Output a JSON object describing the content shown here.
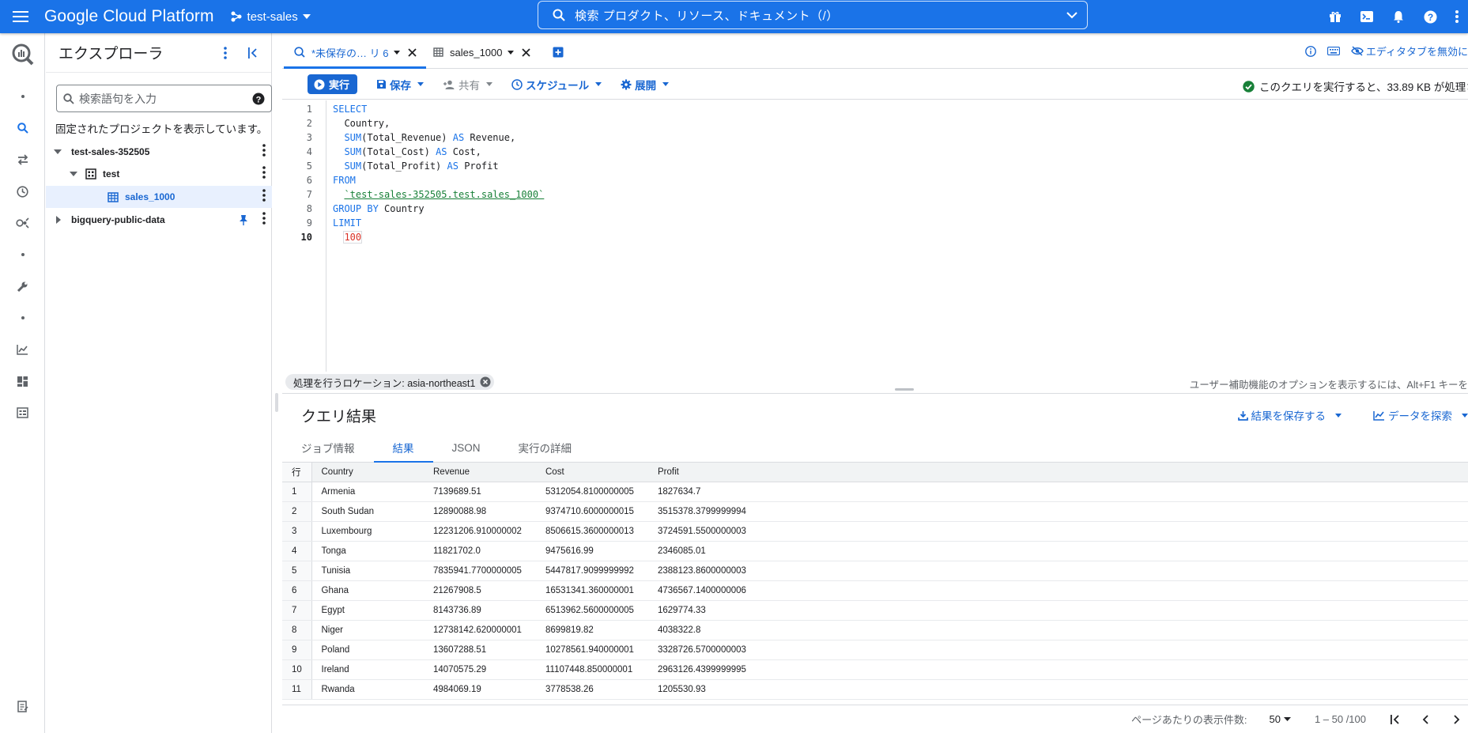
{
  "topbar": {
    "title": "Google Cloud Platform",
    "project": "test-sales",
    "search_text": "検索  プロダクト、リソース、ドキュメント（/）"
  },
  "explorer": {
    "title": "エクスプローラ",
    "search_placeholder": "検索語句を入力",
    "pinned_info": "固定されたプロジェクトを表示しています。",
    "tree": {
      "project": "test-sales-352505",
      "dataset": "test",
      "table": "sales_1000",
      "public_data": "bigquery-public-data"
    }
  },
  "tabs": {
    "query_tab": "*未保存の… リ 6",
    "table_tab": "sales_1000",
    "right_label": "エディタタブを無効に"
  },
  "toolbar": {
    "run": "実行",
    "save": "保存",
    "share": "共有",
    "schedule": "スケジュール",
    "deploy": "展開",
    "status": "このクエリを実行すると、33.89 KB が処理さ"
  },
  "editor": {
    "line_numbers": [
      "1",
      "2",
      "3",
      "4",
      "5",
      "6",
      "7",
      "8",
      "9",
      "10"
    ],
    "lines": {
      "l1_kw": "SELECT",
      "l2": "  Country,",
      "l3_kw": "SUM",
      "l3_rest": "(Total_Revenue) ",
      "l3_as": "AS",
      "l3_alias": " Revenue,",
      "l4_kw": "SUM",
      "l4_rest": "(Total_Cost) ",
      "l4_as": "AS",
      "l4_alias": " Cost,",
      "l5_kw": "SUM",
      "l5_rest": "(Total_Profit) ",
      "l5_as": "AS",
      "l5_alias": " Profit",
      "l6_kw": "FROM",
      "l7_str": "`test-sales-352505.test.sales_1000`",
      "l8_kw": "GROUP BY",
      "l8_rest": " Country",
      "l9_kw": "LIMIT",
      "l10_num": "100"
    }
  },
  "location_chip": "処理を行うロケーション: asia-northeast1",
  "a11y_hint": "ユーザー補助機能のオプションを表示するには、Alt+F1 キーを",
  "results": {
    "title": "クエリ結果",
    "save_results": "結果を保存する",
    "explore_data": "データを探索",
    "tabs": [
      "ジョブ情報",
      "結果",
      "JSON",
      "実行の詳細"
    ],
    "columns": [
      "行",
      "Country",
      "Revenue",
      "Cost",
      "Profit"
    ],
    "rows": [
      [
        "1",
        "Armenia",
        "7139689.51",
        "5312054.8100000005",
        "1827634.7"
      ],
      [
        "2",
        "South Sudan",
        "12890088.98",
        "9374710.6000000015",
        "3515378.3799999994"
      ],
      [
        "3",
        "Luxembourg",
        "12231206.910000002",
        "8506615.3600000013",
        "3724591.5500000003"
      ],
      [
        "4",
        "Tonga",
        "11821702.0",
        "9475616.99",
        "2346085.01"
      ],
      [
        "5",
        "Tunisia",
        "7835941.7700000005",
        "5447817.9099999992",
        "2388123.8600000003"
      ],
      [
        "6",
        "Ghana",
        "21267908.5",
        "16531341.360000001",
        "4736567.1400000006"
      ],
      [
        "7",
        "Egypt",
        "8143736.89",
        "6513962.5600000005",
        "1629774.33"
      ],
      [
        "8",
        "Niger",
        "12738142.620000001",
        "8699819.82",
        "4038322.8"
      ],
      [
        "9",
        "Poland",
        "13607288.51",
        "10278561.940000001",
        "3328726.5700000003"
      ],
      [
        "10",
        "Ireland",
        "14070575.29",
        "11107448.850000001",
        "2963126.4399999995"
      ],
      [
        "11",
        "Rwanda",
        "4984069.19",
        "3778538.26",
        "1205530.93"
      ]
    ],
    "pager": {
      "label": "ページあたりの表示件数:",
      "size": "50",
      "range": "1 – 50 /100"
    }
  },
  "colors": {
    "brand_blue": "#1a73e8",
    "link_blue": "#1967d2",
    "success_green": "#188038",
    "number_red": "#d93025"
  }
}
